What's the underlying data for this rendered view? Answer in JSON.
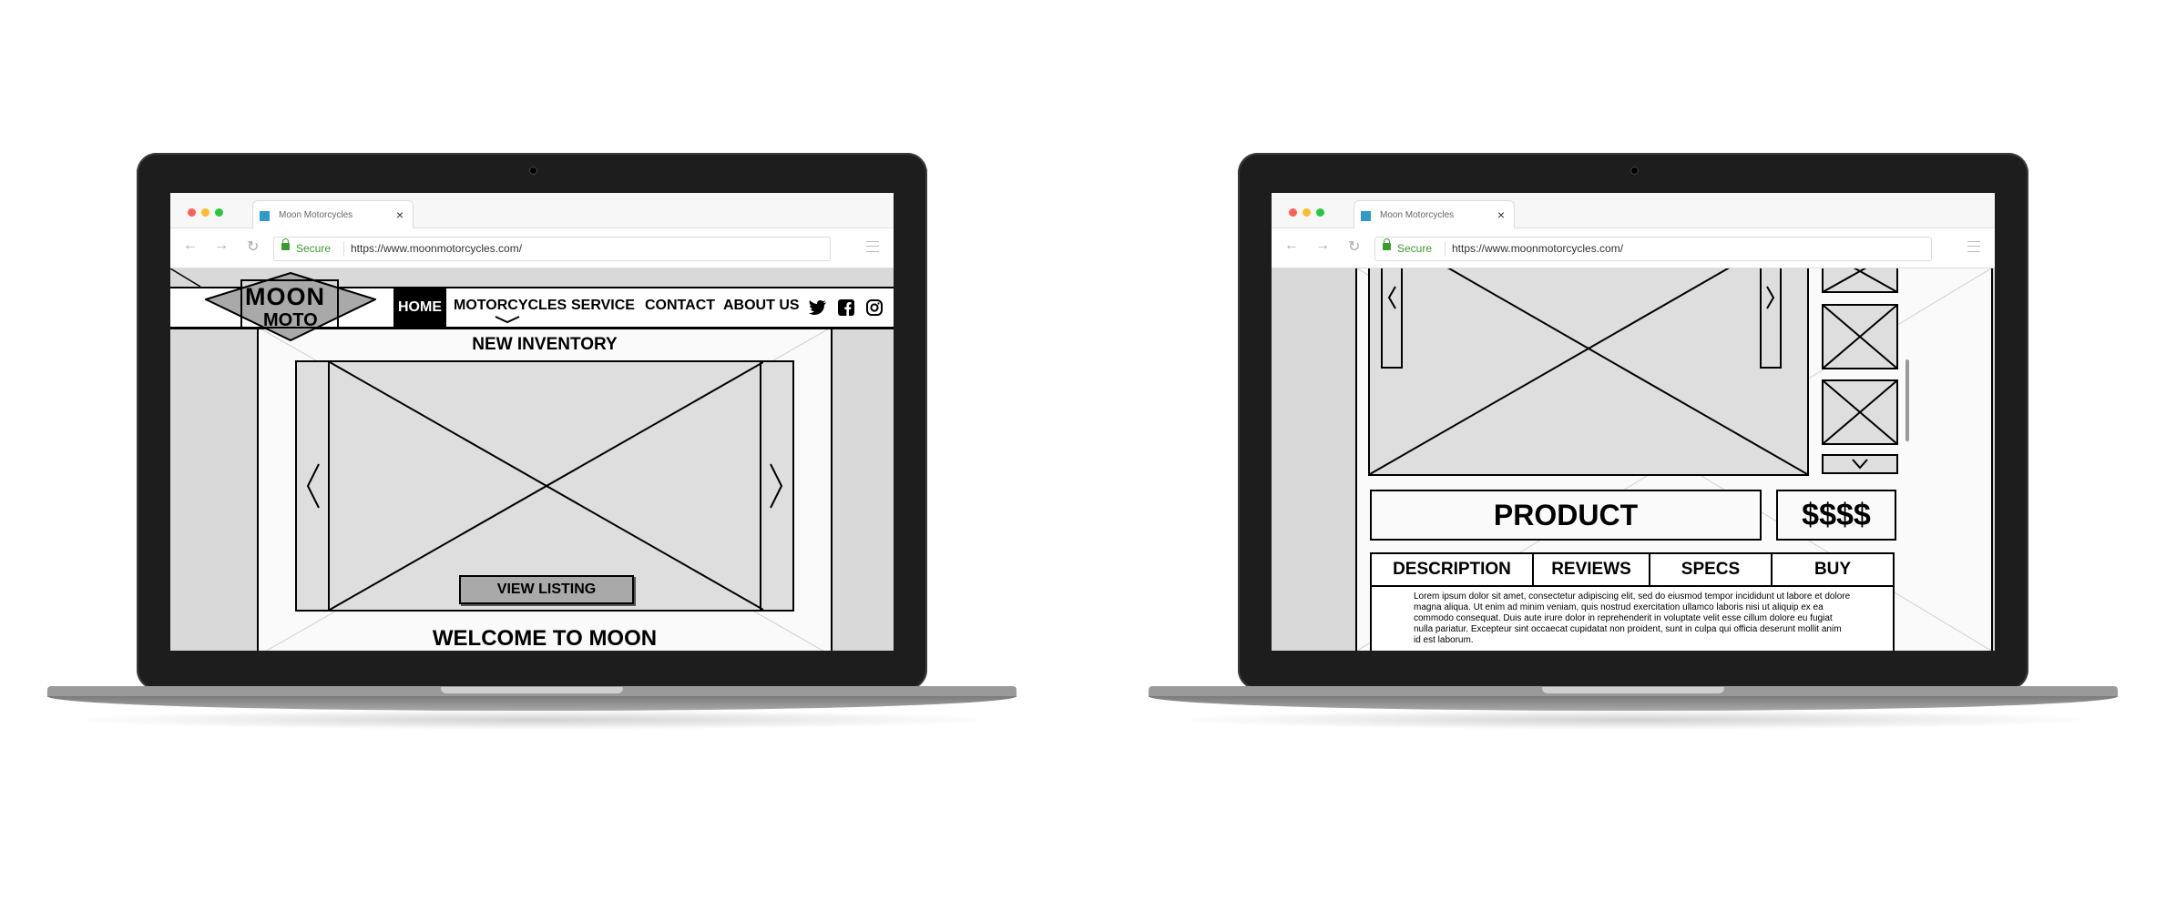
{
  "browser": {
    "tab_title": "Moon Motorcycles",
    "tab_close": "×",
    "secure_label": "Secure",
    "url": "https://www.moonmotorcycles.com/",
    "back": "←",
    "forward": "→",
    "reload": "↻",
    "traffic_colors": [
      "#ff5f57",
      "#febc2e",
      "#28c840"
    ]
  },
  "home": {
    "logo": {
      "line1": "MOON",
      "line2": "MOTO"
    },
    "nav": [
      "HOME",
      "MOTORCYCLES",
      "SERVICE",
      "CONTACT",
      "ABOUT US"
    ],
    "nav_active": "HOME",
    "social_icons": [
      "twitter-icon",
      "facebook-icon",
      "instagram-icon"
    ],
    "section_title": "NEW INVENTORY",
    "cta_button": "VIEW LISTING",
    "next_section_title": "WELCOME TO MOON"
  },
  "product": {
    "product_label": "PRODUCT",
    "price": "$$$$",
    "tabs": [
      "DESCRIPTION",
      "REVIEWS",
      "SPECS",
      "BUY"
    ],
    "description": "Lorem ipsum dolor sit amet, consectetur adipiscing elit, sed do eiusmod tempor incididunt ut labore et dolore magna aliqua. Ut enim ad minim veniam, quis nostrud exercitation ullamco laboris nisi ut aliquip ex ea commodo consequat. Duis aute irure dolor in reprehenderit in voluptate velit esse cillum dolore eu fugiat nulla pariatur. Excepteur sint occaecat cupidatat non proident, sunt in culpa qui officia deserunt mollit anim id est laborum."
  }
}
